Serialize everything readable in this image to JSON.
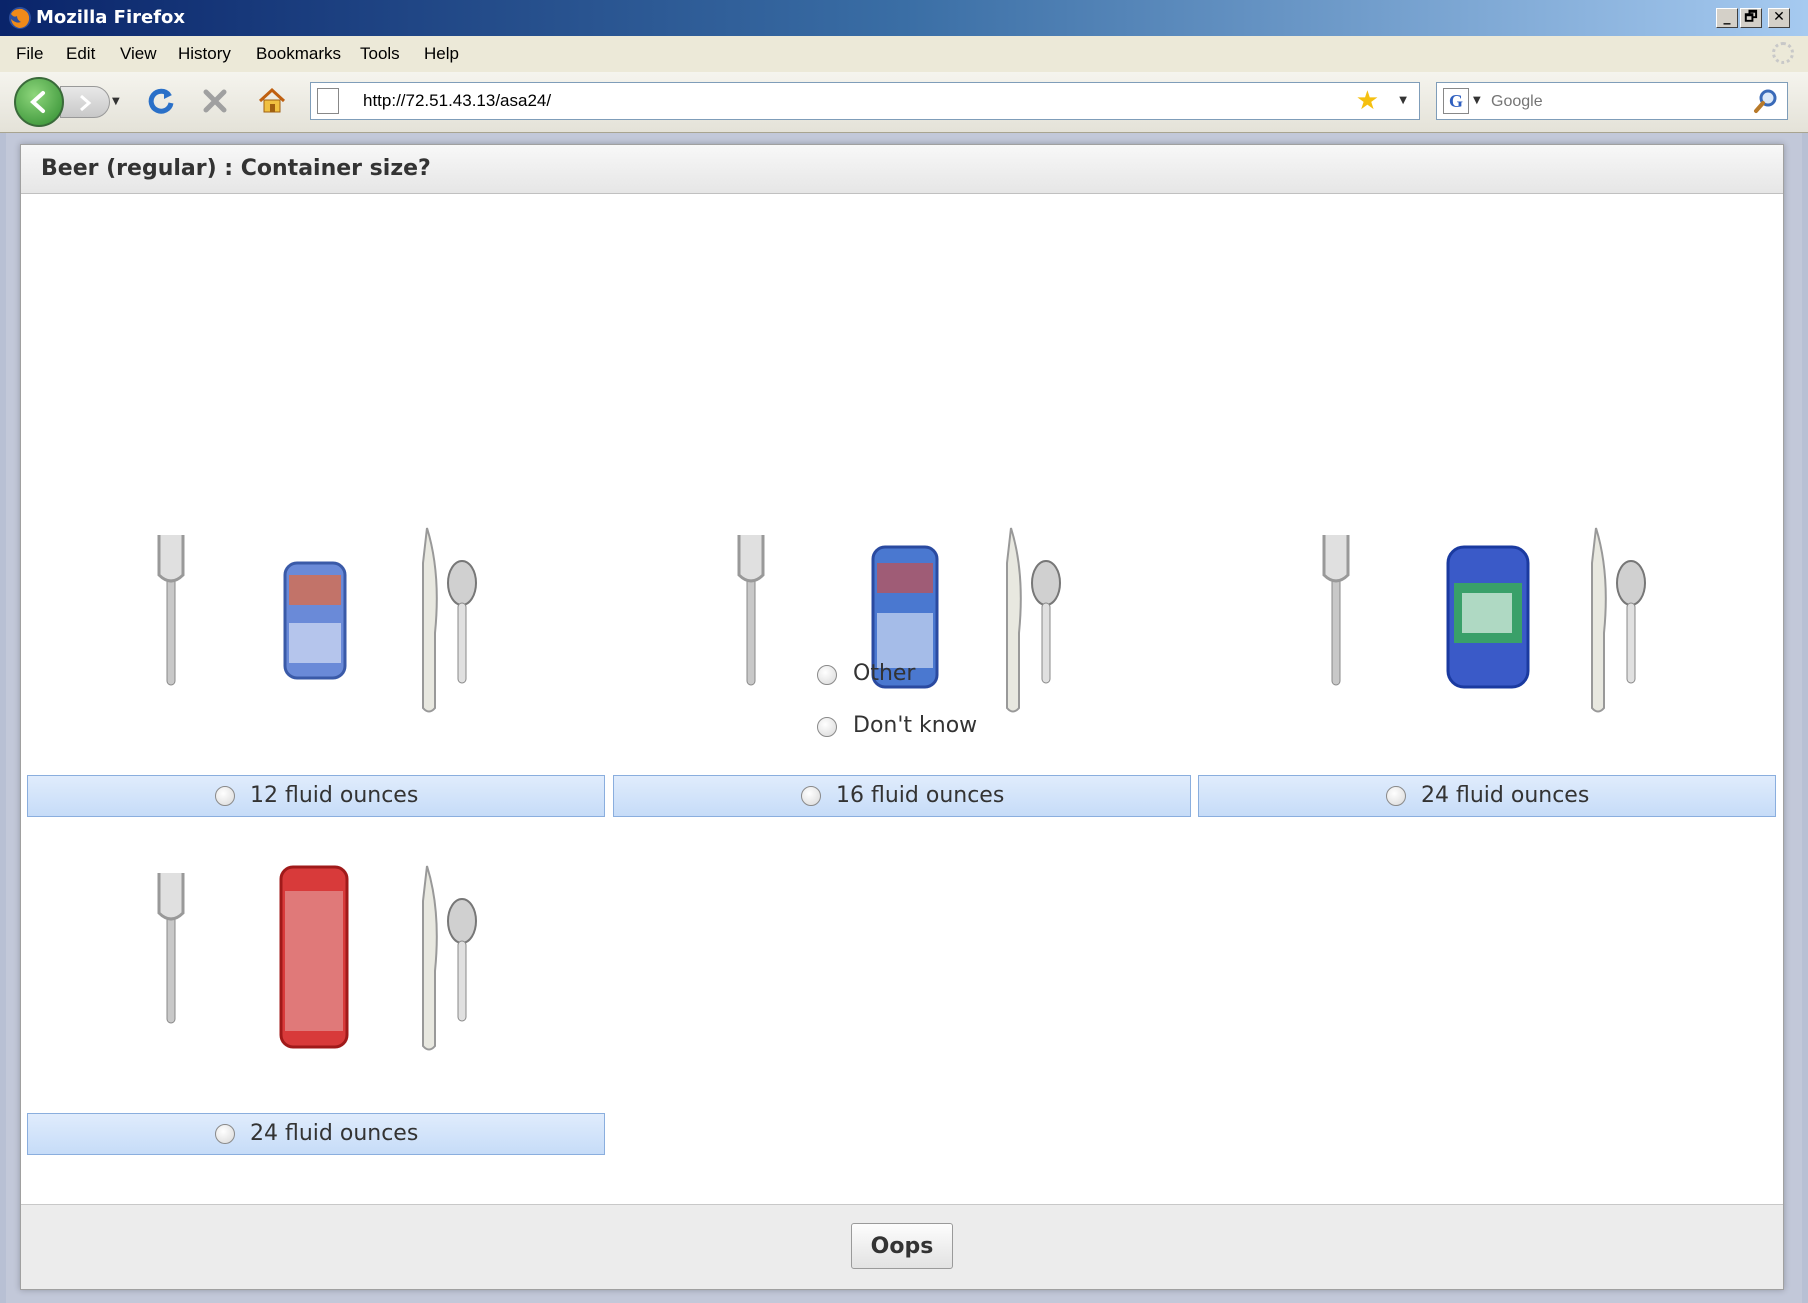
{
  "window": {
    "title": "Mozilla Firefox",
    "controls": [
      "_",
      "🗗",
      "✕"
    ]
  },
  "menu": {
    "items": [
      {
        "label": "File"
      },
      {
        "label": "Edit"
      },
      {
        "label": "View"
      },
      {
        "label": "History"
      },
      {
        "label": "Bookmarks"
      },
      {
        "label": "Tools"
      },
      {
        "label": "Help"
      }
    ]
  },
  "nav": {
    "url": "http://72.51.43.13/asa24/",
    "search_placeholder": "Google",
    "search_engine_icon": "G"
  },
  "dialog": {
    "question": "Beer (regular) : Container size?",
    "options": [
      {
        "label": "12 fluid ounces",
        "can": {
          "color": "#6a8ad8",
          "accent": "#e86a3a",
          "shape": "short-can"
        }
      },
      {
        "label": "16 fluid ounces",
        "can": {
          "color": "#4a78d0",
          "accent": "#d84a3a",
          "shape": "tall-can"
        }
      },
      {
        "label": "24 fluid ounces",
        "can": {
          "color": "#3a5ac8",
          "accent": "#3ab84a",
          "shape": "wide-can"
        }
      },
      {
        "label": "24 fluid ounces",
        "can": {
          "color": "#d83a3a",
          "accent": "#f0f0f0",
          "shape": "tallboy-can"
        }
      }
    ],
    "extra_options": [
      {
        "label": "Other"
      },
      {
        "label": "Don't know"
      }
    ],
    "footer": {
      "oops_label": "Oops"
    }
  }
}
